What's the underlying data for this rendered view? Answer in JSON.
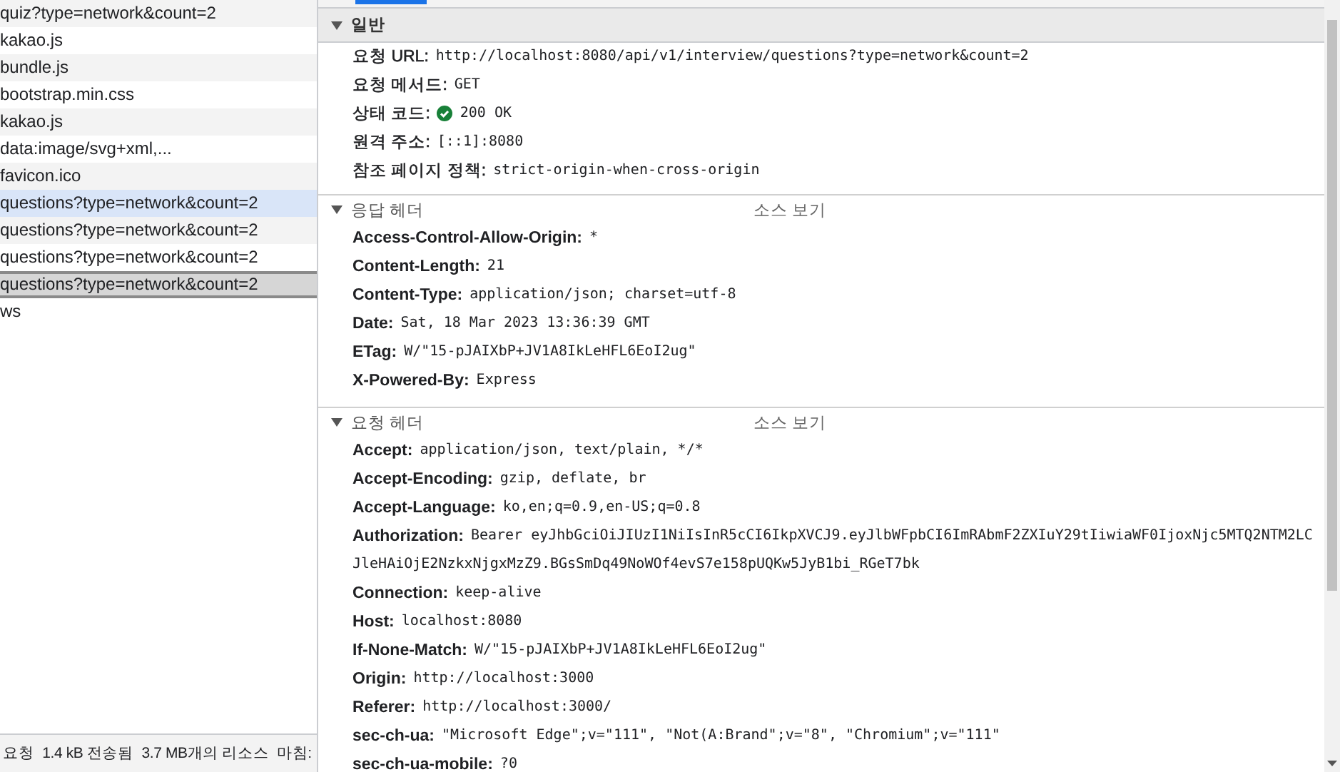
{
  "requests": [
    {
      "name": "quiz?type=network&count=2",
      "selected": false,
      "hovered": false
    },
    {
      "name": "kakao.js",
      "selected": false,
      "hovered": false
    },
    {
      "name": "bundle.js",
      "selected": false,
      "hovered": false
    },
    {
      "name": "bootstrap.min.css",
      "selected": false,
      "hovered": false
    },
    {
      "name": "kakao.js",
      "selected": false,
      "hovered": false
    },
    {
      "name": "data:image/svg+xml,...",
      "selected": false,
      "hovered": false
    },
    {
      "name": "favicon.ico",
      "selected": false,
      "hovered": false
    },
    {
      "name": "questions?type=network&count=2",
      "selected": false,
      "hovered": true
    },
    {
      "name": "questions?type=network&count=2",
      "selected": false,
      "hovered": false
    },
    {
      "name": "questions?type=network&count=2",
      "selected": false,
      "hovered": false
    },
    {
      "name": "questions?type=network&count=2",
      "selected": true,
      "hovered": false
    },
    {
      "name": "ws",
      "selected": false,
      "hovered": false
    }
  ],
  "status_bar": [
    "요청",
    "1.4 kB 전송됨",
    "3.7 MB개의 리소스",
    "마침:"
  ],
  "sections": [
    {
      "title": "일반",
      "expanded": true,
      "kind": "general",
      "rows": [
        {
          "name": "요청 URL:",
          "value": "http://localhost:8080/api/v1/interview/questions?type=network&count=2"
        },
        {
          "name": "요청 메서드:",
          "value": "GET"
        },
        {
          "name": "상태 코드:",
          "value": "200 OK",
          "status_ok": true
        },
        {
          "name": "원격 주소:",
          "value": "[::1]:8080"
        },
        {
          "name": "참조 페이지 정책:",
          "value": "strict-origin-when-cross-origin"
        }
      ]
    },
    {
      "title": "응답 헤더",
      "expanded": true,
      "kind": "headers",
      "source_link": "소스 보기",
      "rows": [
        {
          "name": "Access-Control-Allow-Origin:",
          "value": "*"
        },
        {
          "name": "Content-Length:",
          "value": "21"
        },
        {
          "name": "Content-Type:",
          "value": "application/json; charset=utf-8"
        },
        {
          "name": "Date:",
          "value": "Sat, 18 Mar 2023 13:36:39 GMT"
        },
        {
          "name": "ETag:",
          "value": "W/\"15-pJAIXbP+JV1A8IkLeHFL6EoI2ug\""
        },
        {
          "name": "X-Powered-By:",
          "value": "Express"
        }
      ]
    },
    {
      "title": "요청 헤더",
      "expanded": true,
      "kind": "headers",
      "source_link": "소스 보기",
      "rows": [
        {
          "name": "Accept:",
          "value": "application/json, text/plain, */*"
        },
        {
          "name": "Accept-Encoding:",
          "value": "gzip, deflate, br"
        },
        {
          "name": "Accept-Language:",
          "value": "ko,en;q=0.9,en-US;q=0.8"
        },
        {
          "name": "Authorization:",
          "value": "Bearer eyJhbGciOiJIUzI1NiIsInR5cCI6IkpXVCJ9.eyJlbWFpbCI6ImRAbmF2ZXIuY29tIiwiaWF0IjoxNjc5MTQ2NTM2LCJleHAiOjE2NzkxNjgxMzZ9.BGsSmDq49NoWOf4evS7e158pUQKw5JyB1bi_RGeT7bk"
        },
        {
          "name": "Connection:",
          "value": "keep-alive"
        },
        {
          "name": "Host:",
          "value": "localhost:8080"
        },
        {
          "name": "If-None-Match:",
          "value": "W/\"15-pJAIXbP+JV1A8IkLeHFL6EoI2ug\""
        },
        {
          "name": "Origin:",
          "value": "http://localhost:3000"
        },
        {
          "name": "Referer:",
          "value": "http://localhost:3000/"
        },
        {
          "name": "sec-ch-ua:",
          "value": "\"Microsoft Edge\";v=\"111\", \"Not(A:Brand\";v=\"8\", \"Chromium\";v=\"111\""
        },
        {
          "name": "sec-ch-ua-mobile:",
          "value": "?0"
        }
      ]
    }
  ]
}
